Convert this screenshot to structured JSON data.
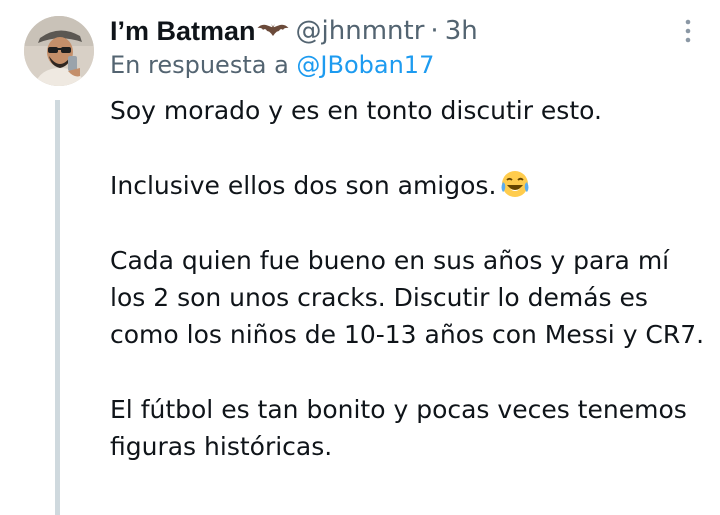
{
  "tweet": {
    "author": {
      "display_name": "I’m Batman",
      "name_emoji_icon": "bat-icon",
      "handle": "@jhnmntr",
      "separator": "·",
      "time": "3h",
      "avatar_icon": "avatar-photo"
    },
    "reply_to": {
      "prefix": "En respuesta a",
      "mention": "@JBoban17"
    },
    "more_icon": "more-vertical-icon",
    "paragraphs": [
      "Soy morado y es en tonto discutir esto.",
      "Inclusive ellos dos son amigos.",
      "Cada quien fue bueno en sus años y para mí los 2 son unos cracks. Discutir lo demás es como los niños de 10-13 años con Messi y CR7.",
      "El fútbol es tan bonito y pocas veces tenemos figuras históricas."
    ],
    "paragraph_2_emoji_icon": "laughing-crying-emoji-icon"
  },
  "colors": {
    "text_primary": "#0f1419",
    "text_secondary": "#536471",
    "mention": "#1d9bf0",
    "thread_line": "#cfd9de"
  }
}
